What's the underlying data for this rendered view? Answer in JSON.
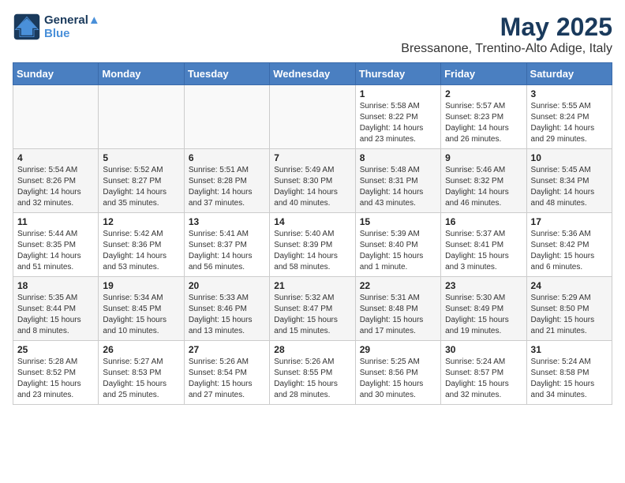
{
  "header": {
    "logo_line1": "General",
    "logo_line2": "Blue",
    "month_year": "May 2025",
    "location": "Bressanone, Trentino-Alto Adige, Italy"
  },
  "days_of_week": [
    "Sunday",
    "Monday",
    "Tuesday",
    "Wednesday",
    "Thursday",
    "Friday",
    "Saturday"
  ],
  "weeks": [
    [
      {
        "day": "",
        "content": ""
      },
      {
        "day": "",
        "content": ""
      },
      {
        "day": "",
        "content": ""
      },
      {
        "day": "",
        "content": ""
      },
      {
        "day": "1",
        "content": "Sunrise: 5:58 AM\nSunset: 8:22 PM\nDaylight: 14 hours\nand 23 minutes."
      },
      {
        "day": "2",
        "content": "Sunrise: 5:57 AM\nSunset: 8:23 PM\nDaylight: 14 hours\nand 26 minutes."
      },
      {
        "day": "3",
        "content": "Sunrise: 5:55 AM\nSunset: 8:24 PM\nDaylight: 14 hours\nand 29 minutes."
      }
    ],
    [
      {
        "day": "4",
        "content": "Sunrise: 5:54 AM\nSunset: 8:26 PM\nDaylight: 14 hours\nand 32 minutes."
      },
      {
        "day": "5",
        "content": "Sunrise: 5:52 AM\nSunset: 8:27 PM\nDaylight: 14 hours\nand 35 minutes."
      },
      {
        "day": "6",
        "content": "Sunrise: 5:51 AM\nSunset: 8:28 PM\nDaylight: 14 hours\nand 37 minutes."
      },
      {
        "day": "7",
        "content": "Sunrise: 5:49 AM\nSunset: 8:30 PM\nDaylight: 14 hours\nand 40 minutes."
      },
      {
        "day": "8",
        "content": "Sunrise: 5:48 AM\nSunset: 8:31 PM\nDaylight: 14 hours\nand 43 minutes."
      },
      {
        "day": "9",
        "content": "Sunrise: 5:46 AM\nSunset: 8:32 PM\nDaylight: 14 hours\nand 46 minutes."
      },
      {
        "day": "10",
        "content": "Sunrise: 5:45 AM\nSunset: 8:34 PM\nDaylight: 14 hours\nand 48 minutes."
      }
    ],
    [
      {
        "day": "11",
        "content": "Sunrise: 5:44 AM\nSunset: 8:35 PM\nDaylight: 14 hours\nand 51 minutes."
      },
      {
        "day": "12",
        "content": "Sunrise: 5:42 AM\nSunset: 8:36 PM\nDaylight: 14 hours\nand 53 minutes."
      },
      {
        "day": "13",
        "content": "Sunrise: 5:41 AM\nSunset: 8:37 PM\nDaylight: 14 hours\nand 56 minutes."
      },
      {
        "day": "14",
        "content": "Sunrise: 5:40 AM\nSunset: 8:39 PM\nDaylight: 14 hours\nand 58 minutes."
      },
      {
        "day": "15",
        "content": "Sunrise: 5:39 AM\nSunset: 8:40 PM\nDaylight: 15 hours\nand 1 minute."
      },
      {
        "day": "16",
        "content": "Sunrise: 5:37 AM\nSunset: 8:41 PM\nDaylight: 15 hours\nand 3 minutes."
      },
      {
        "day": "17",
        "content": "Sunrise: 5:36 AM\nSunset: 8:42 PM\nDaylight: 15 hours\nand 6 minutes."
      }
    ],
    [
      {
        "day": "18",
        "content": "Sunrise: 5:35 AM\nSunset: 8:44 PM\nDaylight: 15 hours\nand 8 minutes."
      },
      {
        "day": "19",
        "content": "Sunrise: 5:34 AM\nSunset: 8:45 PM\nDaylight: 15 hours\nand 10 minutes."
      },
      {
        "day": "20",
        "content": "Sunrise: 5:33 AM\nSunset: 8:46 PM\nDaylight: 15 hours\nand 13 minutes."
      },
      {
        "day": "21",
        "content": "Sunrise: 5:32 AM\nSunset: 8:47 PM\nDaylight: 15 hours\nand 15 minutes."
      },
      {
        "day": "22",
        "content": "Sunrise: 5:31 AM\nSunset: 8:48 PM\nDaylight: 15 hours\nand 17 minutes."
      },
      {
        "day": "23",
        "content": "Sunrise: 5:30 AM\nSunset: 8:49 PM\nDaylight: 15 hours\nand 19 minutes."
      },
      {
        "day": "24",
        "content": "Sunrise: 5:29 AM\nSunset: 8:50 PM\nDaylight: 15 hours\nand 21 minutes."
      }
    ],
    [
      {
        "day": "25",
        "content": "Sunrise: 5:28 AM\nSunset: 8:52 PM\nDaylight: 15 hours\nand 23 minutes."
      },
      {
        "day": "26",
        "content": "Sunrise: 5:27 AM\nSunset: 8:53 PM\nDaylight: 15 hours\nand 25 minutes."
      },
      {
        "day": "27",
        "content": "Sunrise: 5:26 AM\nSunset: 8:54 PM\nDaylight: 15 hours\nand 27 minutes."
      },
      {
        "day": "28",
        "content": "Sunrise: 5:26 AM\nSunset: 8:55 PM\nDaylight: 15 hours\nand 28 minutes."
      },
      {
        "day": "29",
        "content": "Sunrise: 5:25 AM\nSunset: 8:56 PM\nDaylight: 15 hours\nand 30 minutes."
      },
      {
        "day": "30",
        "content": "Sunrise: 5:24 AM\nSunset: 8:57 PM\nDaylight: 15 hours\nand 32 minutes."
      },
      {
        "day": "31",
        "content": "Sunrise: 5:24 AM\nSunset: 8:58 PM\nDaylight: 15 hours\nand 34 minutes."
      }
    ]
  ]
}
